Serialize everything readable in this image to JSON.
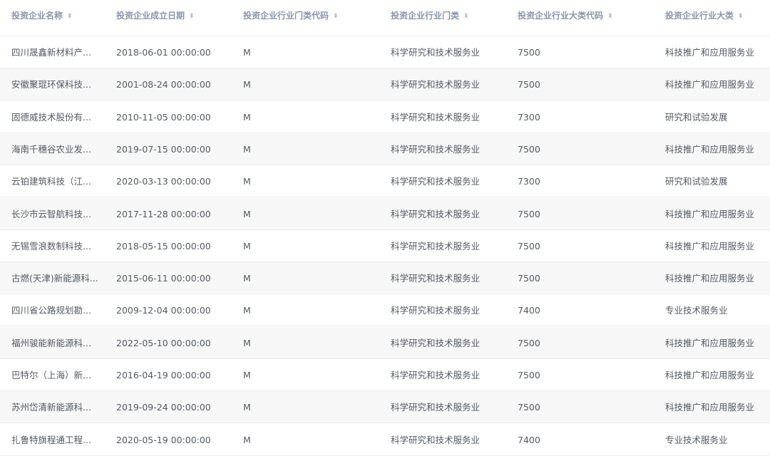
{
  "columns": [
    {
      "label": "投资企业名称",
      "sort_icon": "sort-icon"
    },
    {
      "label": "投资企业成立日期",
      "sort_icon": "sort-icon"
    },
    {
      "label": "投资企业行业门类代码",
      "sort_icon": "sort-icon"
    },
    {
      "label": "投资企业行业门类",
      "sort_icon": "sort-icon"
    },
    {
      "label": "投资企业行业大类代码",
      "sort_icon": "sort-icon"
    },
    {
      "label": "投资企业行业大类",
      "sort_icon": "sort-icon"
    }
  ],
  "sort_glyph": "⬍",
  "rows": [
    {
      "name": "四川晟鑫新材料产...",
      "date": "2018-06-01 00:00:00",
      "sector_code": "M",
      "sector": "科学研究和技术服务业",
      "major_code": "7500",
      "major": "科技推广和应用服务业"
    },
    {
      "name": "安徽聚琨环保科技...",
      "date": "2001-08-24 00:00:00",
      "sector_code": "M",
      "sector": "科学研究和技术服务业",
      "major_code": "7500",
      "major": "科技推广和应用服务业"
    },
    {
      "name": "固德威技术股份有...",
      "date": "2010-11-05 00:00:00",
      "sector_code": "M",
      "sector": "科学研究和技术服务业",
      "major_code": "7300",
      "major": "研究和试验发展"
    },
    {
      "name": "海南千穗谷农业发...",
      "date": "2019-07-15 00:00:00",
      "sector_code": "M",
      "sector": "科学研究和技术服务业",
      "major_code": "7500",
      "major": "科技推广和应用服务业"
    },
    {
      "name": "云铂建筑科技（江...",
      "date": "2020-03-13 00:00:00",
      "sector_code": "M",
      "sector": "科学研究和技术服务业",
      "major_code": "7300",
      "major": "研究和试验发展"
    },
    {
      "name": "长沙市云智航科技...",
      "date": "2017-11-28 00:00:00",
      "sector_code": "M",
      "sector": "科学研究和技术服务业",
      "major_code": "7500",
      "major": "科技推广和应用服务业"
    },
    {
      "name": "无锡雪浪数制科技...",
      "date": "2018-05-15 00:00:00",
      "sector_code": "M",
      "sector": "科学研究和技术服务业",
      "major_code": "7500",
      "major": "科技推广和应用服务业"
    },
    {
      "name": "古燃(天津)新能源科...",
      "date": "2015-06-11 00:00:00",
      "sector_code": "M",
      "sector": "科学研究和技术服务业",
      "major_code": "7500",
      "major": "科技推广和应用服务业"
    },
    {
      "name": "四川省公路规划勘...",
      "date": "2009-12-04 00:00:00",
      "sector_code": "M",
      "sector": "科学研究和技术服务业",
      "major_code": "7400",
      "major": "专业技术服务业"
    },
    {
      "name": "福州骏能新能源科...",
      "date": "2022-05-10 00:00:00",
      "sector_code": "M",
      "sector": "科学研究和技术服务业",
      "major_code": "7500",
      "major": "科技推广和应用服务业"
    },
    {
      "name": "巴特尔（上海）新...",
      "date": "2016-04-19 00:00:00",
      "sector_code": "M",
      "sector": "科学研究和技术服务业",
      "major_code": "7500",
      "major": "科技推广和应用服务业"
    },
    {
      "name": "苏州岱清新能源科...",
      "date": "2019-09-24 00:00:00",
      "sector_code": "M",
      "sector": "科学研究和技术服务业",
      "major_code": "7500",
      "major": "科技推广和应用服务业"
    },
    {
      "name": "扎鲁特旗程通工程...",
      "date": "2020-05-19 00:00:00",
      "sector_code": "M",
      "sector": "科学研究和技术服务业",
      "major_code": "7400",
      "major": "专业技术服务业"
    }
  ]
}
